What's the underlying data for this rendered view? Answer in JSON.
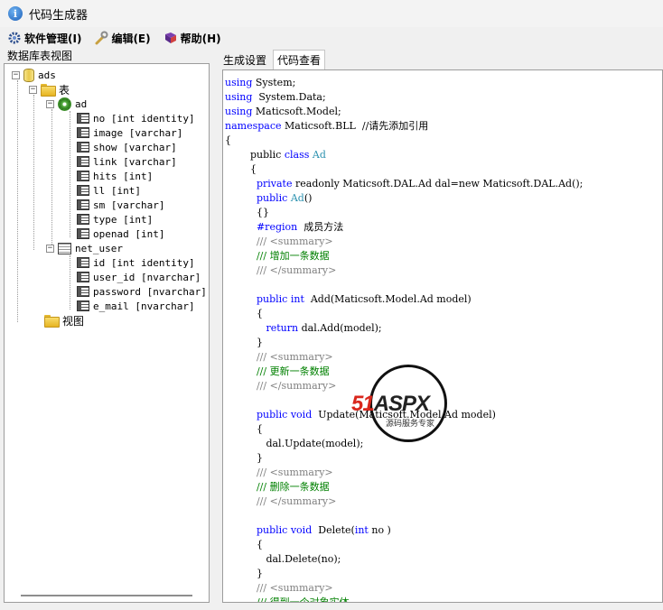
{
  "window": {
    "title": "代码生成器"
  },
  "menu": [
    {
      "label": "软件管理(I)",
      "icon": "settings-icon"
    },
    {
      "label": "编辑(E)",
      "icon": "wrench-icon"
    },
    {
      "label": "帮助(H)",
      "icon": "book-icon"
    }
  ],
  "left_panel": {
    "caption": "数据库表视图"
  },
  "tree": {
    "db": "ads",
    "tables_folder": "表",
    "table_ad": "ad",
    "ad_columns": [
      "no  [int identity]",
      "image  [varchar]",
      "show  [varchar]",
      "link  [varchar]",
      "hits  [int]",
      "ll  [int]",
      "sm  [varchar]",
      "type  [int]",
      "openad  [int]"
    ],
    "table_net_user": "net_user",
    "net_user_columns": [
      "id  [int identity]",
      "user_id  [nvarchar]",
      "password  [nvarchar]",
      "e_mail  [nvarchar]"
    ],
    "views_folder": "视图"
  },
  "tabs": [
    {
      "label": "生成设置",
      "active": false
    },
    {
      "label": "代码查看",
      "active": true
    }
  ],
  "code_lines": [
    [
      [
        "kw",
        "using"
      ],
      [
        "t",
        " System;"
      ]
    ],
    [
      [
        "kw",
        "using"
      ],
      [
        "t",
        "  System.Data;"
      ]
    ],
    [
      [
        "kw",
        "using"
      ],
      [
        "t",
        " Maticsoft.Model;"
      ]
    ],
    [
      [
        "kw",
        "namespace"
      ],
      [
        "t",
        " Maticsoft.BLL  //请先添加引用"
      ]
    ],
    [
      [
        "t",
        "{"
      ]
    ],
    [
      [
        "t",
        "        public "
      ],
      [
        "kw",
        "class"
      ],
      [
        "cls",
        " Ad"
      ]
    ],
    [
      [
        "t",
        "        {"
      ]
    ],
    [
      [
        "t",
        "          "
      ],
      [
        "kw",
        "private"
      ],
      [
        "t",
        " readonly Maticsoft.DAL.Ad dal=new Maticsoft.DAL.Ad();"
      ]
    ],
    [
      [
        "t",
        "          "
      ],
      [
        "kw",
        "public"
      ],
      [
        "cls",
        " Ad"
      ],
      [
        "t",
        "()"
      ]
    ],
    [
      [
        "t",
        "          {}"
      ]
    ],
    [
      [
        "t",
        "          "
      ],
      [
        "kw",
        "#region"
      ],
      [
        "t",
        "  成员方法"
      ]
    ],
    [
      [
        "t",
        "          "
      ],
      [
        "doc",
        "/// <summary>"
      ]
    ],
    [
      [
        "t",
        "          "
      ],
      [
        "cm",
        "/// 增加一条数据"
      ]
    ],
    [
      [
        "t",
        "          "
      ],
      [
        "doc",
        "/// </summary>"
      ]
    ],
    [
      [
        "t",
        ""
      ]
    ],
    [
      [
        "t",
        "          "
      ],
      [
        "kw",
        "public"
      ],
      [
        "t",
        " "
      ],
      [
        "kw",
        "int"
      ],
      [
        "t",
        "  Add(Maticsoft.Model.Ad model)"
      ]
    ],
    [
      [
        "t",
        "          {"
      ]
    ],
    [
      [
        "t",
        "             "
      ],
      [
        "kw",
        "return"
      ],
      [
        "t",
        " dal.Add(model);"
      ]
    ],
    [
      [
        "t",
        "          }"
      ]
    ],
    [
      [
        "t",
        "          "
      ],
      [
        "doc",
        "/// <summary>"
      ]
    ],
    [
      [
        "t",
        "          "
      ],
      [
        "cm",
        "/// 更新一条数据"
      ]
    ],
    [
      [
        "t",
        "          "
      ],
      [
        "doc",
        "/// </summary>"
      ]
    ],
    [
      [
        "t",
        ""
      ]
    ],
    [
      [
        "t",
        "          "
      ],
      [
        "kw",
        "public"
      ],
      [
        "t",
        " "
      ],
      [
        "kw",
        "void"
      ],
      [
        "t",
        "  Update(Maticsoft.Model.Ad model)"
      ]
    ],
    [
      [
        "t",
        "          {"
      ]
    ],
    [
      [
        "t",
        "             dal.Update(model);"
      ]
    ],
    [
      [
        "t",
        "          }"
      ]
    ],
    [
      [
        "t",
        "          "
      ],
      [
        "doc",
        "/// <summary>"
      ]
    ],
    [
      [
        "t",
        "          "
      ],
      [
        "cm",
        "/// 删除一条数据"
      ]
    ],
    [
      [
        "t",
        "          "
      ],
      [
        "doc",
        "/// </summary>"
      ]
    ],
    [
      [
        "t",
        ""
      ]
    ],
    [
      [
        "t",
        "          "
      ],
      [
        "kw",
        "public"
      ],
      [
        "t",
        " "
      ],
      [
        "kw",
        "void"
      ],
      [
        "t",
        "  Delete("
      ],
      [
        "kw",
        "int"
      ],
      [
        "t",
        " no )"
      ]
    ],
    [
      [
        "t",
        "          {"
      ]
    ],
    [
      [
        "t",
        "             dal.Delete(no);"
      ]
    ],
    [
      [
        "t",
        "          }"
      ]
    ],
    [
      [
        "t",
        "          "
      ],
      [
        "doc",
        "/// <summary>"
      ]
    ],
    [
      [
        "t",
        "          "
      ],
      [
        "cm",
        "/// 得到一个对象实体"
      ]
    ]
  ],
  "watermark": {
    "brand_red": "51",
    "brand_dark": "ASPX",
    "subtitle": "源码服务专家"
  },
  "colors": {
    "keyword": "#0000ff",
    "class_name": "#2b91af",
    "comment": "#008000",
    "doc_tag": "#808080"
  }
}
